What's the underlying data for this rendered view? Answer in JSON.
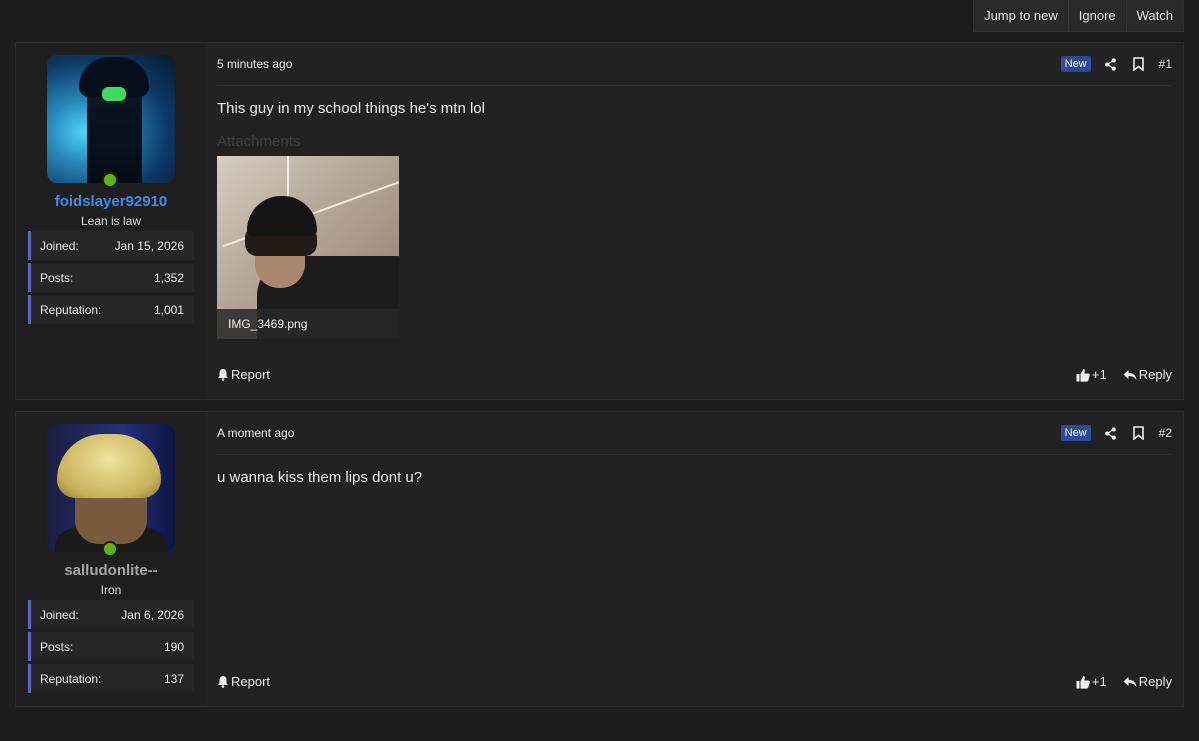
{
  "topbar": {
    "jump_label": "Jump to new",
    "ignore_label": "Ignore",
    "watch_label": "Watch"
  },
  "posts": [
    {
      "time": "5 minutes ago",
      "badge": "New",
      "number": "#1",
      "body": "This guy in my school things he's mtn lol",
      "attachments_title": "Attachments",
      "attachment_name": "IMG_3469.png",
      "report_label": "Report",
      "like_label": "+1",
      "reply_label": "Reply",
      "user": {
        "name": "foidslayer92910",
        "title": "Lean is law",
        "stats": [
          {
            "label": "Joined:",
            "value": "Jan 15, 2026"
          },
          {
            "label": "Posts:",
            "value": "1,352"
          },
          {
            "label": "Reputation:",
            "value": "1,001"
          }
        ]
      }
    },
    {
      "time": "A moment ago",
      "badge": "New",
      "number": "#2",
      "body": "u wanna kiss them lips dont u?",
      "report_label": "Report",
      "like_label": "+1",
      "reply_label": "Reply",
      "user": {
        "name": "salludonlite--",
        "title": "Iron",
        "stats": [
          {
            "label": "Joined:",
            "value": "Jan 6, 2026"
          },
          {
            "label": "Posts:",
            "value": "190"
          },
          {
            "label": "Reputation:",
            "value": "137"
          }
        ]
      }
    }
  ],
  "colors": {
    "accent_blue": "#3a8de5",
    "stat_border": "#5866c8",
    "badge_new": "#2d4a9a",
    "online": "#5fb312"
  }
}
